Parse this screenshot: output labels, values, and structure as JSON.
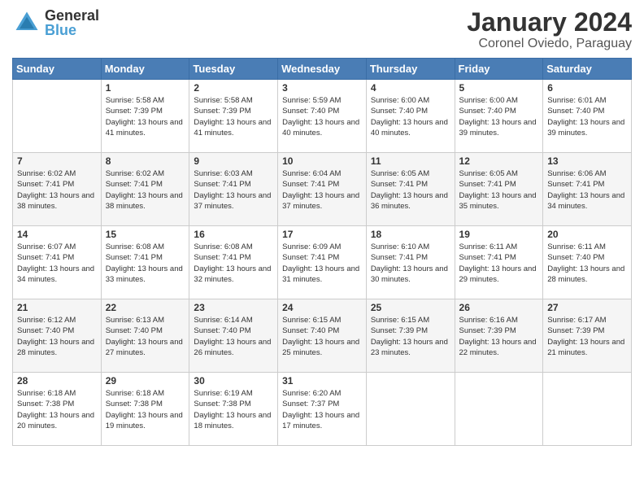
{
  "header": {
    "logo_general": "General",
    "logo_blue": "Blue",
    "month_title": "January 2024",
    "location": "Coronel Oviedo, Paraguay"
  },
  "days_of_week": [
    "Sunday",
    "Monday",
    "Tuesday",
    "Wednesday",
    "Thursday",
    "Friday",
    "Saturday"
  ],
  "weeks": [
    [
      {
        "day": "",
        "sunrise": "",
        "sunset": "",
        "daylight": ""
      },
      {
        "day": "1",
        "sunrise": "Sunrise: 5:58 AM",
        "sunset": "Sunset: 7:39 PM",
        "daylight": "Daylight: 13 hours and 41 minutes."
      },
      {
        "day": "2",
        "sunrise": "Sunrise: 5:58 AM",
        "sunset": "Sunset: 7:39 PM",
        "daylight": "Daylight: 13 hours and 41 minutes."
      },
      {
        "day": "3",
        "sunrise": "Sunrise: 5:59 AM",
        "sunset": "Sunset: 7:40 PM",
        "daylight": "Daylight: 13 hours and 40 minutes."
      },
      {
        "day": "4",
        "sunrise": "Sunrise: 6:00 AM",
        "sunset": "Sunset: 7:40 PM",
        "daylight": "Daylight: 13 hours and 40 minutes."
      },
      {
        "day": "5",
        "sunrise": "Sunrise: 6:00 AM",
        "sunset": "Sunset: 7:40 PM",
        "daylight": "Daylight: 13 hours and 39 minutes."
      },
      {
        "day": "6",
        "sunrise": "Sunrise: 6:01 AM",
        "sunset": "Sunset: 7:40 PM",
        "daylight": "Daylight: 13 hours and 39 minutes."
      }
    ],
    [
      {
        "day": "7",
        "sunrise": "Sunrise: 6:02 AM",
        "sunset": "Sunset: 7:41 PM",
        "daylight": "Daylight: 13 hours and 38 minutes."
      },
      {
        "day": "8",
        "sunrise": "Sunrise: 6:02 AM",
        "sunset": "Sunset: 7:41 PM",
        "daylight": "Daylight: 13 hours and 38 minutes."
      },
      {
        "day": "9",
        "sunrise": "Sunrise: 6:03 AM",
        "sunset": "Sunset: 7:41 PM",
        "daylight": "Daylight: 13 hours and 37 minutes."
      },
      {
        "day": "10",
        "sunrise": "Sunrise: 6:04 AM",
        "sunset": "Sunset: 7:41 PM",
        "daylight": "Daylight: 13 hours and 37 minutes."
      },
      {
        "day": "11",
        "sunrise": "Sunrise: 6:05 AM",
        "sunset": "Sunset: 7:41 PM",
        "daylight": "Daylight: 13 hours and 36 minutes."
      },
      {
        "day": "12",
        "sunrise": "Sunrise: 6:05 AM",
        "sunset": "Sunset: 7:41 PM",
        "daylight": "Daylight: 13 hours and 35 minutes."
      },
      {
        "day": "13",
        "sunrise": "Sunrise: 6:06 AM",
        "sunset": "Sunset: 7:41 PM",
        "daylight": "Daylight: 13 hours and 34 minutes."
      }
    ],
    [
      {
        "day": "14",
        "sunrise": "Sunrise: 6:07 AM",
        "sunset": "Sunset: 7:41 PM",
        "daylight": "Daylight: 13 hours and 34 minutes."
      },
      {
        "day": "15",
        "sunrise": "Sunrise: 6:08 AM",
        "sunset": "Sunset: 7:41 PM",
        "daylight": "Daylight: 13 hours and 33 minutes."
      },
      {
        "day": "16",
        "sunrise": "Sunrise: 6:08 AM",
        "sunset": "Sunset: 7:41 PM",
        "daylight": "Daylight: 13 hours and 32 minutes."
      },
      {
        "day": "17",
        "sunrise": "Sunrise: 6:09 AM",
        "sunset": "Sunset: 7:41 PM",
        "daylight": "Daylight: 13 hours and 31 minutes."
      },
      {
        "day": "18",
        "sunrise": "Sunrise: 6:10 AM",
        "sunset": "Sunset: 7:41 PM",
        "daylight": "Daylight: 13 hours and 30 minutes."
      },
      {
        "day": "19",
        "sunrise": "Sunrise: 6:11 AM",
        "sunset": "Sunset: 7:41 PM",
        "daylight": "Daylight: 13 hours and 29 minutes."
      },
      {
        "day": "20",
        "sunrise": "Sunrise: 6:11 AM",
        "sunset": "Sunset: 7:40 PM",
        "daylight": "Daylight: 13 hours and 28 minutes."
      }
    ],
    [
      {
        "day": "21",
        "sunrise": "Sunrise: 6:12 AM",
        "sunset": "Sunset: 7:40 PM",
        "daylight": "Daylight: 13 hours and 28 minutes."
      },
      {
        "day": "22",
        "sunrise": "Sunrise: 6:13 AM",
        "sunset": "Sunset: 7:40 PM",
        "daylight": "Daylight: 13 hours and 27 minutes."
      },
      {
        "day": "23",
        "sunrise": "Sunrise: 6:14 AM",
        "sunset": "Sunset: 7:40 PM",
        "daylight": "Daylight: 13 hours and 26 minutes."
      },
      {
        "day": "24",
        "sunrise": "Sunrise: 6:15 AM",
        "sunset": "Sunset: 7:40 PM",
        "daylight": "Daylight: 13 hours and 25 minutes."
      },
      {
        "day": "25",
        "sunrise": "Sunrise: 6:15 AM",
        "sunset": "Sunset: 7:39 PM",
        "daylight": "Daylight: 13 hours and 23 minutes."
      },
      {
        "day": "26",
        "sunrise": "Sunrise: 6:16 AM",
        "sunset": "Sunset: 7:39 PM",
        "daylight": "Daylight: 13 hours and 22 minutes."
      },
      {
        "day": "27",
        "sunrise": "Sunrise: 6:17 AM",
        "sunset": "Sunset: 7:39 PM",
        "daylight": "Daylight: 13 hours and 21 minutes."
      }
    ],
    [
      {
        "day": "28",
        "sunrise": "Sunrise: 6:18 AM",
        "sunset": "Sunset: 7:38 PM",
        "daylight": "Daylight: 13 hours and 20 minutes."
      },
      {
        "day": "29",
        "sunrise": "Sunrise: 6:18 AM",
        "sunset": "Sunset: 7:38 PM",
        "daylight": "Daylight: 13 hours and 19 minutes."
      },
      {
        "day": "30",
        "sunrise": "Sunrise: 6:19 AM",
        "sunset": "Sunset: 7:38 PM",
        "daylight": "Daylight: 13 hours and 18 minutes."
      },
      {
        "day": "31",
        "sunrise": "Sunrise: 6:20 AM",
        "sunset": "Sunset: 7:37 PM",
        "daylight": "Daylight: 13 hours and 17 minutes."
      },
      {
        "day": "",
        "sunrise": "",
        "sunset": "",
        "daylight": ""
      },
      {
        "day": "",
        "sunrise": "",
        "sunset": "",
        "daylight": ""
      },
      {
        "day": "",
        "sunrise": "",
        "sunset": "",
        "daylight": ""
      }
    ]
  ]
}
